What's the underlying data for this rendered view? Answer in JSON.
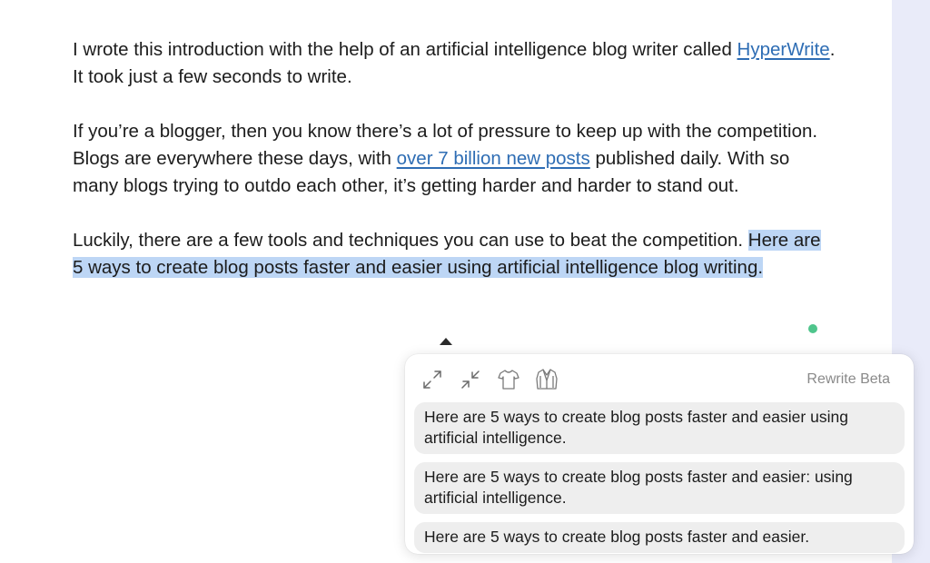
{
  "document": {
    "p1_before_link": "I wrote this introduction with the help of an artificial intelligence blog writer called ",
    "p1_link": "HyperWrite",
    "p1_after_link": ". It took just a few seconds to write.",
    "p2_before_link": "If you’re a blogger, then you know there’s a lot of pressure to keep up with the competition. Blogs are everywhere these days, with ",
    "p2_link": "over 7 billion new posts",
    "p2_after_link": " published daily. With so many blogs trying to outdo each other, it’s getting harder and harder to stand out.",
    "p3_text": "Luckily, there are a few tools and techniques you can use to beat the competition. ",
    "p3_selected": "Here are 5 ways to create blog posts faster and easier using artificial intelligence blog writing."
  },
  "popup": {
    "title": "Rewrite Beta",
    "tools": [
      {
        "icon": "expand-icon"
      },
      {
        "icon": "shorten-icon"
      },
      {
        "icon": "casual-shirt-icon"
      },
      {
        "icon": "formal-jacket-icon"
      }
    ],
    "suggestions": [
      "Here are 5 ways to create blog posts faster and easier using artificial intelligence.",
      "Here are 5 ways to create blog posts faster and easier: using artificial intelligence.",
      "Here are 5 ways to create blog posts faster and easier."
    ]
  },
  "colors": {
    "link": "#2e6db4",
    "selection": "#bdd6f5",
    "status_dot": "#4fc58c",
    "suggestion_bg": "#eeeeee"
  }
}
